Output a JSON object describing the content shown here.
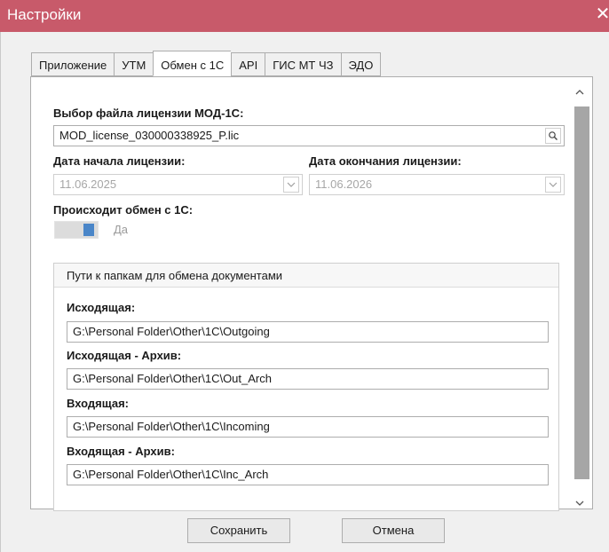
{
  "window": {
    "title": "Настройки",
    "close_glyph": "✕"
  },
  "tabs": [
    {
      "label": "Приложение",
      "active": false
    },
    {
      "label": "УТМ",
      "active": false
    },
    {
      "label": "Обмен с 1С",
      "active": true
    },
    {
      "label": "API",
      "active": false
    },
    {
      "label": "ГИС МТ ЧЗ",
      "active": false
    },
    {
      "label": "ЭДО",
      "active": false
    }
  ],
  "license": {
    "file_label": "Выбор файла лицензии МОД-1С:",
    "file_value": "MOD_license_030000338925_P.lic",
    "start_label": "Дата начала лицензии:",
    "start_value": "11.06.2025",
    "end_label": "Дата окончания лицензии:",
    "end_value": "11.06.2026"
  },
  "exchange": {
    "label": "Происходит обмен с 1С:",
    "toggle_text": "Да",
    "enabled": true
  },
  "folders": {
    "group_title": "Пути к папкам для обмена документами",
    "outgoing_label": "Исходящая:",
    "outgoing_value": "G:\\Personal Folder\\Other\\1C\\Outgoing",
    "outgoing_archive_label": "Исходящая - Архив:",
    "outgoing_archive_value": "G:\\Personal Folder\\Other\\1C\\Out_Arch",
    "incoming_label": "Входящая:",
    "incoming_value": "G:\\Personal Folder\\Other\\1C\\Incoming",
    "incoming_archive_label": "Входящая - Архив:",
    "incoming_archive_value": "G:\\Personal Folder\\Other\\1C\\Inc_Arch"
  },
  "buttons": {
    "save": "Сохранить",
    "cancel": "Отмена"
  },
  "icons": {
    "close": "close-icon",
    "search": "search-icon",
    "dropdown": "chevron-down-icon",
    "scroll_up": "chevron-up-icon",
    "scroll_down": "chevron-down-icon"
  },
  "colors": {
    "titlebar": "#c85a6a",
    "toggle_knob": "#4a86c8",
    "scroll_thumb": "#a6a6a6"
  }
}
